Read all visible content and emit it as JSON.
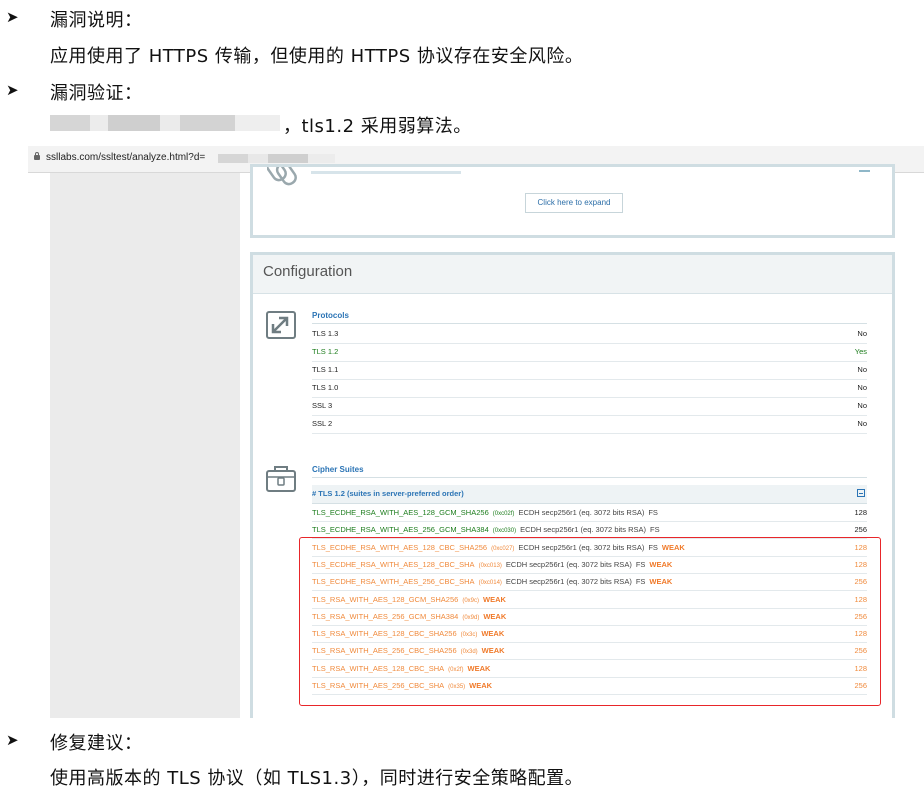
{
  "bullets": [
    {
      "label": "漏洞说明：",
      "text": "应用使用了 HTTPS 传输，但使用的 HTTPS 协议存在安全风险。"
    },
    {
      "label": "漏洞验证：",
      "text": "，tls1.2 采用弱算法。"
    },
    {
      "label": "修复建议：",
      "text": "使用高版本的 TLS 协议（如 TLS1.3），同时进行安全策略配置。"
    }
  ],
  "screenshot": {
    "url": "ssllabs.com/ssltest/analyze.html?d=",
    "expand_button": "Click here to expand",
    "config_title": "Configuration",
    "protocols_title": "Protocols",
    "protocols": [
      {
        "name": "TLS 1.3",
        "value": "No",
        "color": "#222222"
      },
      {
        "name": "TLS 1.2",
        "value": "Yes",
        "color": "#1d7d1d"
      },
      {
        "name": "TLS 1.1",
        "value": "No",
        "color": "#222222"
      },
      {
        "name": "TLS 1.0",
        "value": "No",
        "color": "#222222"
      },
      {
        "name": "SSL 3",
        "value": "No",
        "color": "#222222"
      },
      {
        "name": "SSL 2",
        "value": "No",
        "color": "#222222"
      }
    ],
    "cipher_title": "Cipher Suites",
    "tls12_header": "# TLS 1.2 (suites in server-preferred order)",
    "suites": [
      {
        "name": "TLS_ECDHE_RSA_WITH_AES_128_GCM_SHA256",
        "code": "(0xc02f)",
        "kex": "ECDH secp256r1 (eq. 3072 bits RSA)",
        "fs": "FS",
        "weak": "",
        "bits": "128",
        "color": "#1d7d1d"
      },
      {
        "name": "TLS_ECDHE_RSA_WITH_AES_256_GCM_SHA384",
        "code": "(0xc030)",
        "kex": "ECDH secp256r1 (eq. 3072 bits RSA)",
        "fs": "FS",
        "weak": "",
        "bits": "256",
        "color": "#1d7d1d"
      },
      {
        "name": "TLS_ECDHE_RSA_WITH_AES_128_CBC_SHA256",
        "code": "(0xc027)",
        "kex": "ECDH secp256r1 (eq. 3072 bits RSA)",
        "fs": "FS",
        "weak": "WEAK",
        "bits": "128",
        "color": "#f08a3c"
      },
      {
        "name": "TLS_ECDHE_RSA_WITH_AES_128_CBC_SHA",
        "code": "(0xc013)",
        "kex": "ECDH secp256r1 (eq. 3072 bits RSA)",
        "fs": "FS",
        "weak": "WEAK",
        "bits": "128",
        "color": "#f08a3c"
      },
      {
        "name": "TLS_ECDHE_RSA_WITH_AES_256_CBC_SHA",
        "code": "(0xc014)",
        "kex": "ECDH secp256r1 (eq. 3072 bits RSA)",
        "fs": "FS",
        "weak": "WEAK",
        "bits": "256",
        "color": "#f08a3c"
      },
      {
        "name": "TLS_RSA_WITH_AES_128_GCM_SHA256",
        "code": "(0x9c)",
        "kex": "",
        "fs": "",
        "weak": "WEAK",
        "bits": "128",
        "color": "#f08a3c"
      },
      {
        "name": "TLS_RSA_WITH_AES_256_GCM_SHA384",
        "code": "(0x9d)",
        "kex": "",
        "fs": "",
        "weak": "WEAK",
        "bits": "256",
        "color": "#f08a3c"
      },
      {
        "name": "TLS_RSA_WITH_AES_128_CBC_SHA256",
        "code": "(0x3c)",
        "kex": "",
        "fs": "",
        "weak": "WEAK",
        "bits": "128",
        "color": "#f08a3c"
      },
      {
        "name": "TLS_RSA_WITH_AES_256_CBC_SHA256",
        "code": "(0x3d)",
        "kex": "",
        "fs": "",
        "weak": "WEAK",
        "bits": "256",
        "color": "#f08a3c"
      },
      {
        "name": "TLS_RSA_WITH_AES_128_CBC_SHA",
        "code": "(0x2f)",
        "kex": "",
        "fs": "",
        "weak": "WEAK",
        "bits": "128",
        "color": "#f08a3c"
      },
      {
        "name": "TLS_RSA_WITH_AES_256_CBC_SHA",
        "code": "(0x35)",
        "kex": "",
        "fs": "",
        "weak": "WEAK",
        "bits": "256",
        "color": "#f08a3c"
      }
    ]
  }
}
